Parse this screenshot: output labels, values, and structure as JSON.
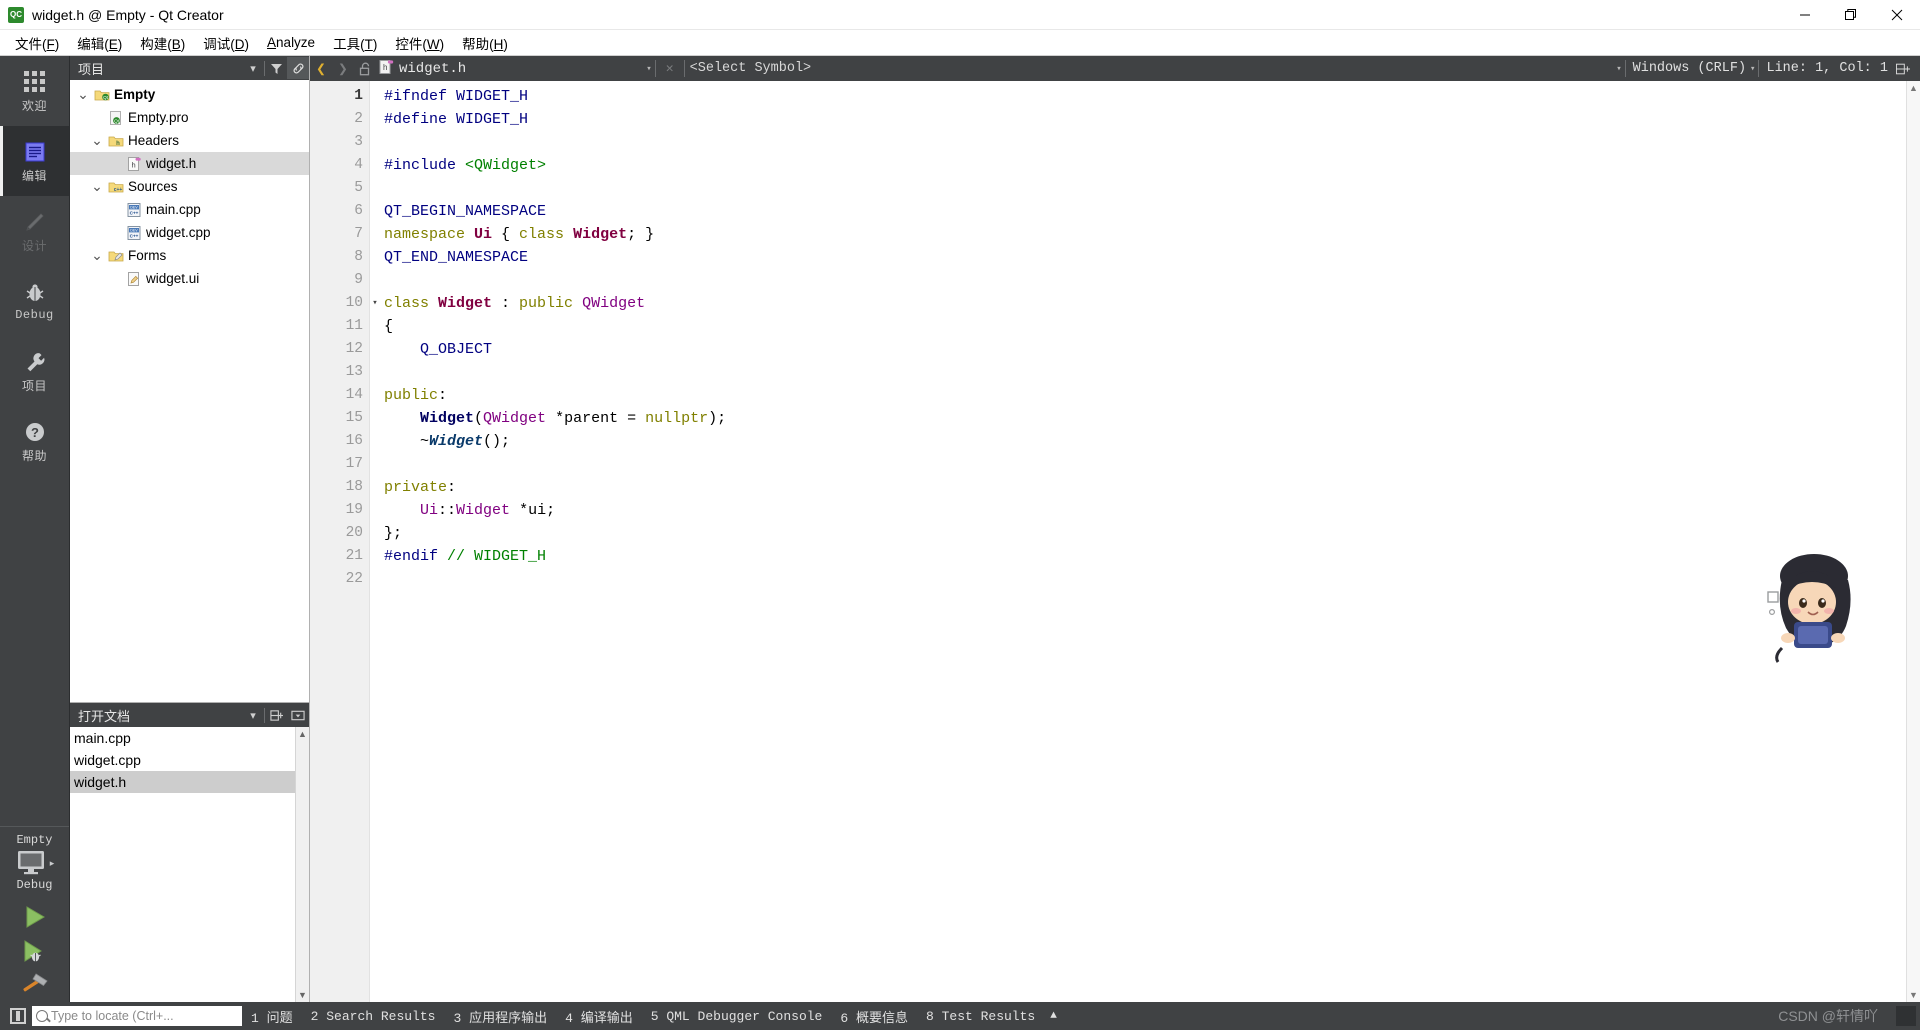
{
  "window": {
    "title": "widget.h @ Empty - Qt Creator",
    "app_icon": "qt-creator-icon",
    "minimize": "—",
    "maximize": "❐",
    "close": "✕"
  },
  "menubar": {
    "items": [
      {
        "label": "文件(F)",
        "name": "menu-file"
      },
      {
        "label": "编辑(E)",
        "name": "menu-edit"
      },
      {
        "label": "构建(B)",
        "name": "menu-build"
      },
      {
        "label": "调试(D)",
        "name": "menu-debug"
      },
      {
        "label": "Analyze",
        "name": "menu-analyze"
      },
      {
        "label": "工具(T)",
        "name": "menu-tools"
      },
      {
        "label": "控件(W)",
        "name": "menu-window"
      },
      {
        "label": "帮助(H)",
        "name": "menu-help"
      }
    ]
  },
  "modebar": {
    "items": [
      {
        "label": "欢迎",
        "icon": "grid-icon",
        "state": "normal"
      },
      {
        "label": "编辑",
        "icon": "document-icon",
        "state": "active"
      },
      {
        "label": "设计",
        "icon": "pencil-icon",
        "state": "disabled"
      },
      {
        "label": "Debug",
        "icon": "bug-icon",
        "state": "normal"
      },
      {
        "label": "项目",
        "icon": "wrench-icon",
        "state": "normal"
      },
      {
        "label": "帮助",
        "icon": "question-icon",
        "state": "normal"
      }
    ],
    "kit": {
      "project": "Empty",
      "build_config": "Debug",
      "target_icon": "monitor-icon",
      "run_label": "run-button",
      "debug_label": "run-debug-button",
      "build_label": "build-button"
    }
  },
  "projects_pane": {
    "title": "项目",
    "filter_icon": "filter-icon",
    "link_icon": "link-icon",
    "dropdown_icon": "chevron-down-icon",
    "tree": [
      {
        "label": "Empty",
        "indent": 0,
        "icon": "qt-project-icon",
        "expander": "˅",
        "bold": true,
        "selected": false
      },
      {
        "label": "Empty.pro",
        "indent": 1,
        "icon": "pro-file-icon",
        "expander": "",
        "bold": false,
        "selected": false
      },
      {
        "label": "Headers",
        "indent": 1,
        "icon": "folder-h-icon",
        "expander": "˅",
        "bold": false,
        "selected": false
      },
      {
        "label": "widget.h",
        "indent": 2,
        "icon": "header-file-icon",
        "expander": "",
        "bold": false,
        "selected": true
      },
      {
        "label": "Sources",
        "indent": 1,
        "icon": "folder-cpp-icon",
        "expander": "˅",
        "bold": false,
        "selected": false
      },
      {
        "label": "main.cpp",
        "indent": 2,
        "icon": "cpp-file-icon",
        "expander": "",
        "bold": false,
        "selected": false
      },
      {
        "label": "widget.cpp",
        "indent": 2,
        "icon": "cpp-file-icon",
        "expander": "",
        "bold": false,
        "selected": false
      },
      {
        "label": "Forms",
        "indent": 1,
        "icon": "folder-ui-icon",
        "expander": "˅",
        "bold": false,
        "selected": false
      },
      {
        "label": "widget.ui",
        "indent": 2,
        "icon": "ui-file-icon",
        "expander": "",
        "bold": false,
        "selected": false
      }
    ]
  },
  "open_documents": {
    "title": "打开文档",
    "dropdown_icon": "chevron-down-icon",
    "split_icon": "split-icon",
    "close_icon": "minimize-pane-icon",
    "items": [
      {
        "label": "main.cpp",
        "selected": false
      },
      {
        "label": "widget.cpp",
        "selected": false
      },
      {
        "label": "widget.h",
        "selected": true
      }
    ]
  },
  "editor_toolbar": {
    "back_icon": "back-arrow-icon",
    "forward_icon": "forward-arrow-icon",
    "lock_icon": "unlocked-icon",
    "file_icon": "header-file-icon",
    "file_name": "widget.h",
    "close_icon": "close-icon",
    "symbol_selector": "<Select Symbol>",
    "line_ending": "Windows (CRLF)",
    "cursor_position": "Line: 1, Col: 1",
    "split_icon": "split-editor-icon"
  },
  "editor": {
    "language": "C++ header",
    "total_lines": 22,
    "current_line": 1,
    "lines": [
      {
        "n": 1,
        "fold": "",
        "tokens": [
          {
            "t": "#ifndef ",
            "c": "pre"
          },
          {
            "t": "WIDGET_H",
            "c": "pre"
          }
        ]
      },
      {
        "n": 2,
        "fold": "",
        "tokens": [
          {
            "t": "#define ",
            "c": "pre"
          },
          {
            "t": "WIDGET_H",
            "c": "pre"
          }
        ]
      },
      {
        "n": 3,
        "fold": "",
        "tokens": []
      },
      {
        "n": 4,
        "fold": "",
        "tokens": [
          {
            "t": "#include ",
            "c": "pre"
          },
          {
            "t": "<QWidget>",
            "c": "str"
          }
        ]
      },
      {
        "n": 5,
        "fold": "",
        "tokens": []
      },
      {
        "n": 6,
        "fold": "",
        "tokens": [
          {
            "t": "QT_BEGIN_NAMESPACE",
            "c": "mac"
          }
        ]
      },
      {
        "n": 7,
        "fold": "",
        "tokens": [
          {
            "t": "namespace ",
            "c": "kw"
          },
          {
            "t": "Ui",
            "c": "cls"
          },
          {
            "t": " { ",
            "c": "plain"
          },
          {
            "t": "class ",
            "c": "kw"
          },
          {
            "t": "Widget",
            "c": "cls"
          },
          {
            "t": "; }",
            "c": "plain"
          }
        ]
      },
      {
        "n": 8,
        "fold": "",
        "tokens": [
          {
            "t": "QT_END_NAMESPACE",
            "c": "mac"
          }
        ]
      },
      {
        "n": 9,
        "fold": "",
        "tokens": []
      },
      {
        "n": 10,
        "fold": "▾",
        "tokens": [
          {
            "t": "class ",
            "c": "kw"
          },
          {
            "t": "Widget",
            "c": "cls"
          },
          {
            "t": " : ",
            "c": "plain"
          },
          {
            "t": "public ",
            "c": "kw"
          },
          {
            "t": "QWidget",
            "c": "type"
          }
        ]
      },
      {
        "n": 11,
        "fold": "",
        "tokens": [
          {
            "t": "{",
            "c": "plain"
          }
        ]
      },
      {
        "n": 12,
        "fold": "",
        "tokens": [
          {
            "t": "    Q_OBJECT",
            "c": "mac"
          }
        ]
      },
      {
        "n": 13,
        "fold": "",
        "tokens": []
      },
      {
        "n": 14,
        "fold": "",
        "tokens": [
          {
            "t": "public",
            "c": "kw"
          },
          {
            "t": ":",
            "c": "plain"
          }
        ]
      },
      {
        "n": 15,
        "fold": "",
        "tokens": [
          {
            "t": "    ",
            "c": "plain"
          },
          {
            "t": "Widget",
            "c": "fn"
          },
          {
            "t": "(",
            "c": "plain"
          },
          {
            "t": "QWidget ",
            "c": "type"
          },
          {
            "t": "*parent",
            "c": "plain"
          },
          {
            "t": " = ",
            "c": "plain"
          },
          {
            "t": "nullptr",
            "c": "kw"
          },
          {
            "t": ");",
            "c": "plain"
          }
        ]
      },
      {
        "n": 16,
        "fold": "",
        "tokens": [
          {
            "t": "    ~",
            "c": "plain"
          },
          {
            "t": "Widget",
            "c": "cls-i"
          },
          {
            "t": "();",
            "c": "plain"
          }
        ]
      },
      {
        "n": 17,
        "fold": "",
        "tokens": []
      },
      {
        "n": 18,
        "fold": "",
        "tokens": [
          {
            "t": "private",
            "c": "kw"
          },
          {
            "t": ":",
            "c": "plain"
          }
        ]
      },
      {
        "n": 19,
        "fold": "",
        "tokens": [
          {
            "t": "    ",
            "c": "plain"
          },
          {
            "t": "Ui",
            "c": "type"
          },
          {
            "t": "::",
            "c": "plain"
          },
          {
            "t": "Widget",
            "c": "type"
          },
          {
            "t": " *ui;",
            "c": "plain"
          }
        ]
      },
      {
        "n": 20,
        "fold": "",
        "tokens": [
          {
            "t": "};",
            "c": "plain"
          }
        ]
      },
      {
        "n": 21,
        "fold": "",
        "tokens": [
          {
            "t": "#endif ",
            "c": "pre"
          },
          {
            "t": "// WIDGET_H",
            "c": "cmt"
          }
        ]
      },
      {
        "n": 22,
        "fold": "",
        "tokens": []
      }
    ]
  },
  "statusbar": {
    "sidebar_toggle": "sidebar-toggle-icon",
    "locator_placeholder": "Type to locate (Ctrl+...",
    "panes": [
      {
        "num": "1",
        "label": "问题"
      },
      {
        "num": "2",
        "label": "Search Results"
      },
      {
        "num": "3",
        "label": "应用程序输出"
      },
      {
        "num": "4",
        "label": "编译输出"
      },
      {
        "num": "5",
        "label": "QML Debugger Console"
      },
      {
        "num": "6",
        "label": "概要信息"
      },
      {
        "num": "8",
        "label": "Test Results"
      }
    ],
    "updown_icon": "updown-arrows-icon",
    "watermark": "CSDN @轩情吖"
  },
  "colors": {
    "dark_chrome": "#404244",
    "mode_active": "#2e3032",
    "gutter_bg": "#f0f0f0",
    "selection": "#d9d9d9",
    "accent_green": "#8bbf62"
  }
}
